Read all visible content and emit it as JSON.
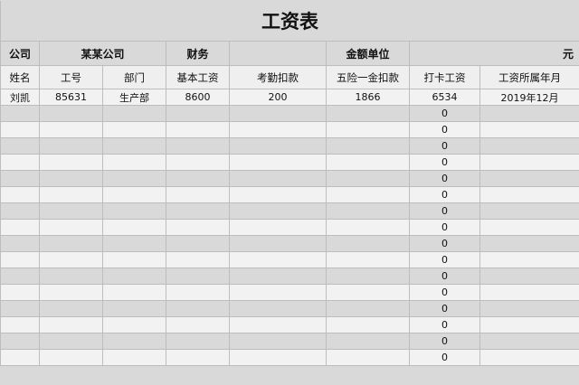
{
  "title": "工资表",
  "info": {
    "company_label": "公司",
    "company_value": "某某公司",
    "dept_value": "财务",
    "unit_label": "金额单位",
    "unit_value": "元"
  },
  "headers": [
    "姓名",
    "工号",
    "部门",
    "基本工资",
    "考勤扣款",
    "五险一金扣款",
    "打卡工资",
    "工资所属年月"
  ],
  "rows": [
    [
      "刘凯",
      "85631",
      "生产部",
      "8600",
      "200",
      "1866",
      "6534",
      "2019年12月"
    ],
    [
      "",
      "",
      "",
      "",
      "",
      "",
      "0",
      ""
    ],
    [
      "",
      "",
      "",
      "",
      "",
      "",
      "0",
      ""
    ],
    [
      "",
      "",
      "",
      "",
      "",
      "",
      "0",
      ""
    ],
    [
      "",
      "",
      "",
      "",
      "",
      "",
      "0",
      ""
    ],
    [
      "",
      "",
      "",
      "",
      "",
      "",
      "0",
      ""
    ],
    [
      "",
      "",
      "",
      "",
      "",
      "",
      "0",
      ""
    ],
    [
      "",
      "",
      "",
      "",
      "",
      "",
      "0",
      ""
    ],
    [
      "",
      "",
      "",
      "",
      "",
      "",
      "0",
      ""
    ],
    [
      "",
      "",
      "",
      "",
      "",
      "",
      "0",
      ""
    ],
    [
      "",
      "",
      "",
      "",
      "",
      "",
      "0",
      ""
    ],
    [
      "",
      "",
      "",
      "",
      "",
      "",
      "0",
      ""
    ],
    [
      "",
      "",
      "",
      "",
      "",
      "",
      "0",
      ""
    ],
    [
      "",
      "",
      "",
      "",
      "",
      "",
      "0",
      ""
    ],
    [
      "",
      "",
      "",
      "",
      "",
      "",
      "0",
      ""
    ],
    [
      "",
      "",
      "",
      "",
      "",
      "",
      "0",
      ""
    ],
    [
      "",
      "",
      "",
      "",
      "",
      "",
      "0",
      ""
    ]
  ]
}
